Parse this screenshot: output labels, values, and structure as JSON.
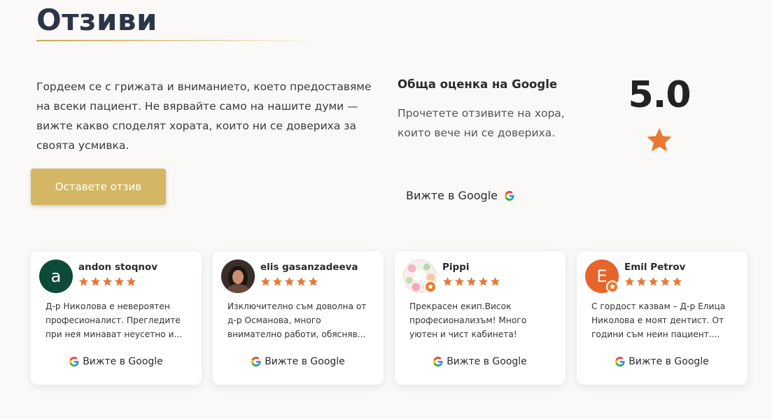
{
  "section": {
    "title": "Отзиви",
    "intro": "Гордеем се с грижата и вниманието, което предоставяме на всеки пациент. Не вярвайте само на нашите думи — вижте какво споделят хората, които ни се довериха за своята усмивка.",
    "leave_review_label": "Оставете отзив"
  },
  "google_overall": {
    "title": "Обща оценка на Google",
    "text": "Прочетете отзивите на хора, които вече ни се довериха.",
    "link_label": "Вижте в Google",
    "score": "5.0",
    "rating_stars": 1
  },
  "colors": {
    "accent_gold": "#d4b664",
    "star_orange": "#e8792f",
    "title_navy": "#2c3547"
  },
  "reviews": [
    {
      "name": "andon stoqnov",
      "avatar_initial": "a",
      "avatar_color": "#0d4a3a",
      "rating": 5,
      "text": "Д-р Николова е невероятен професионалист. Прегледите при нея минават неусетно и...",
      "link_label": "Вижте в Google"
    },
    {
      "name": "elis gasanzadeeva",
      "avatar_initial": "",
      "avatar_color": "#4a3a30",
      "rating": 5,
      "text": "Изключително съм доволна от д-р Османова, много внимателно работи, обясняв...",
      "link_label": "Вижте в Google"
    },
    {
      "name": "Pippi",
      "avatar_initial": "",
      "avatar_color": "#f3ece6",
      "rating": 5,
      "text": "Прекрасен екип.Висок професионализъм! Много уютен и чист кабинета!",
      "link_label": "Вижте в Google"
    },
    {
      "name": "Emil Petrov",
      "avatar_initial": "E",
      "avatar_color": "#e5652b",
      "rating": 5,
      "text": "С гордост казвам – Д-р Елица Николова е моят дентист. От години съм неин пациент....",
      "link_label": "Вижте в Google"
    }
  ]
}
